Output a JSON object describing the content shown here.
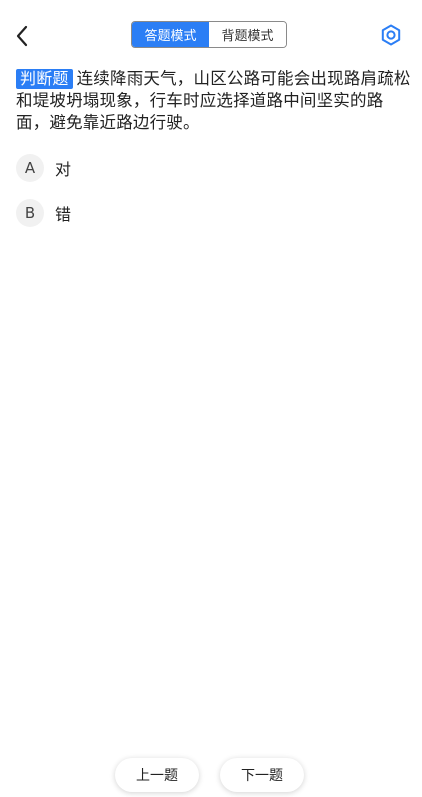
{
  "header": {
    "back_icon": "chevron-left-icon",
    "modes": [
      {
        "label": "答题模式",
        "active": true
      },
      {
        "label": "背题模式",
        "active": false
      }
    ],
    "settings_icon": "settings-icon",
    "accent_color": "#2b7ef5"
  },
  "question": {
    "type_label": "判断题",
    "text": "连续降雨天气，山区公路可能会出现路肩疏松和堤坡坍塌现象，行车时应选择道路中间坚实的路面，避免靠近路边行驶。"
  },
  "options": [
    {
      "letter": "A",
      "text": "对"
    },
    {
      "letter": "B",
      "text": "错"
    }
  ],
  "footer": {
    "prev_label": "上一题",
    "next_label": "下一题"
  }
}
